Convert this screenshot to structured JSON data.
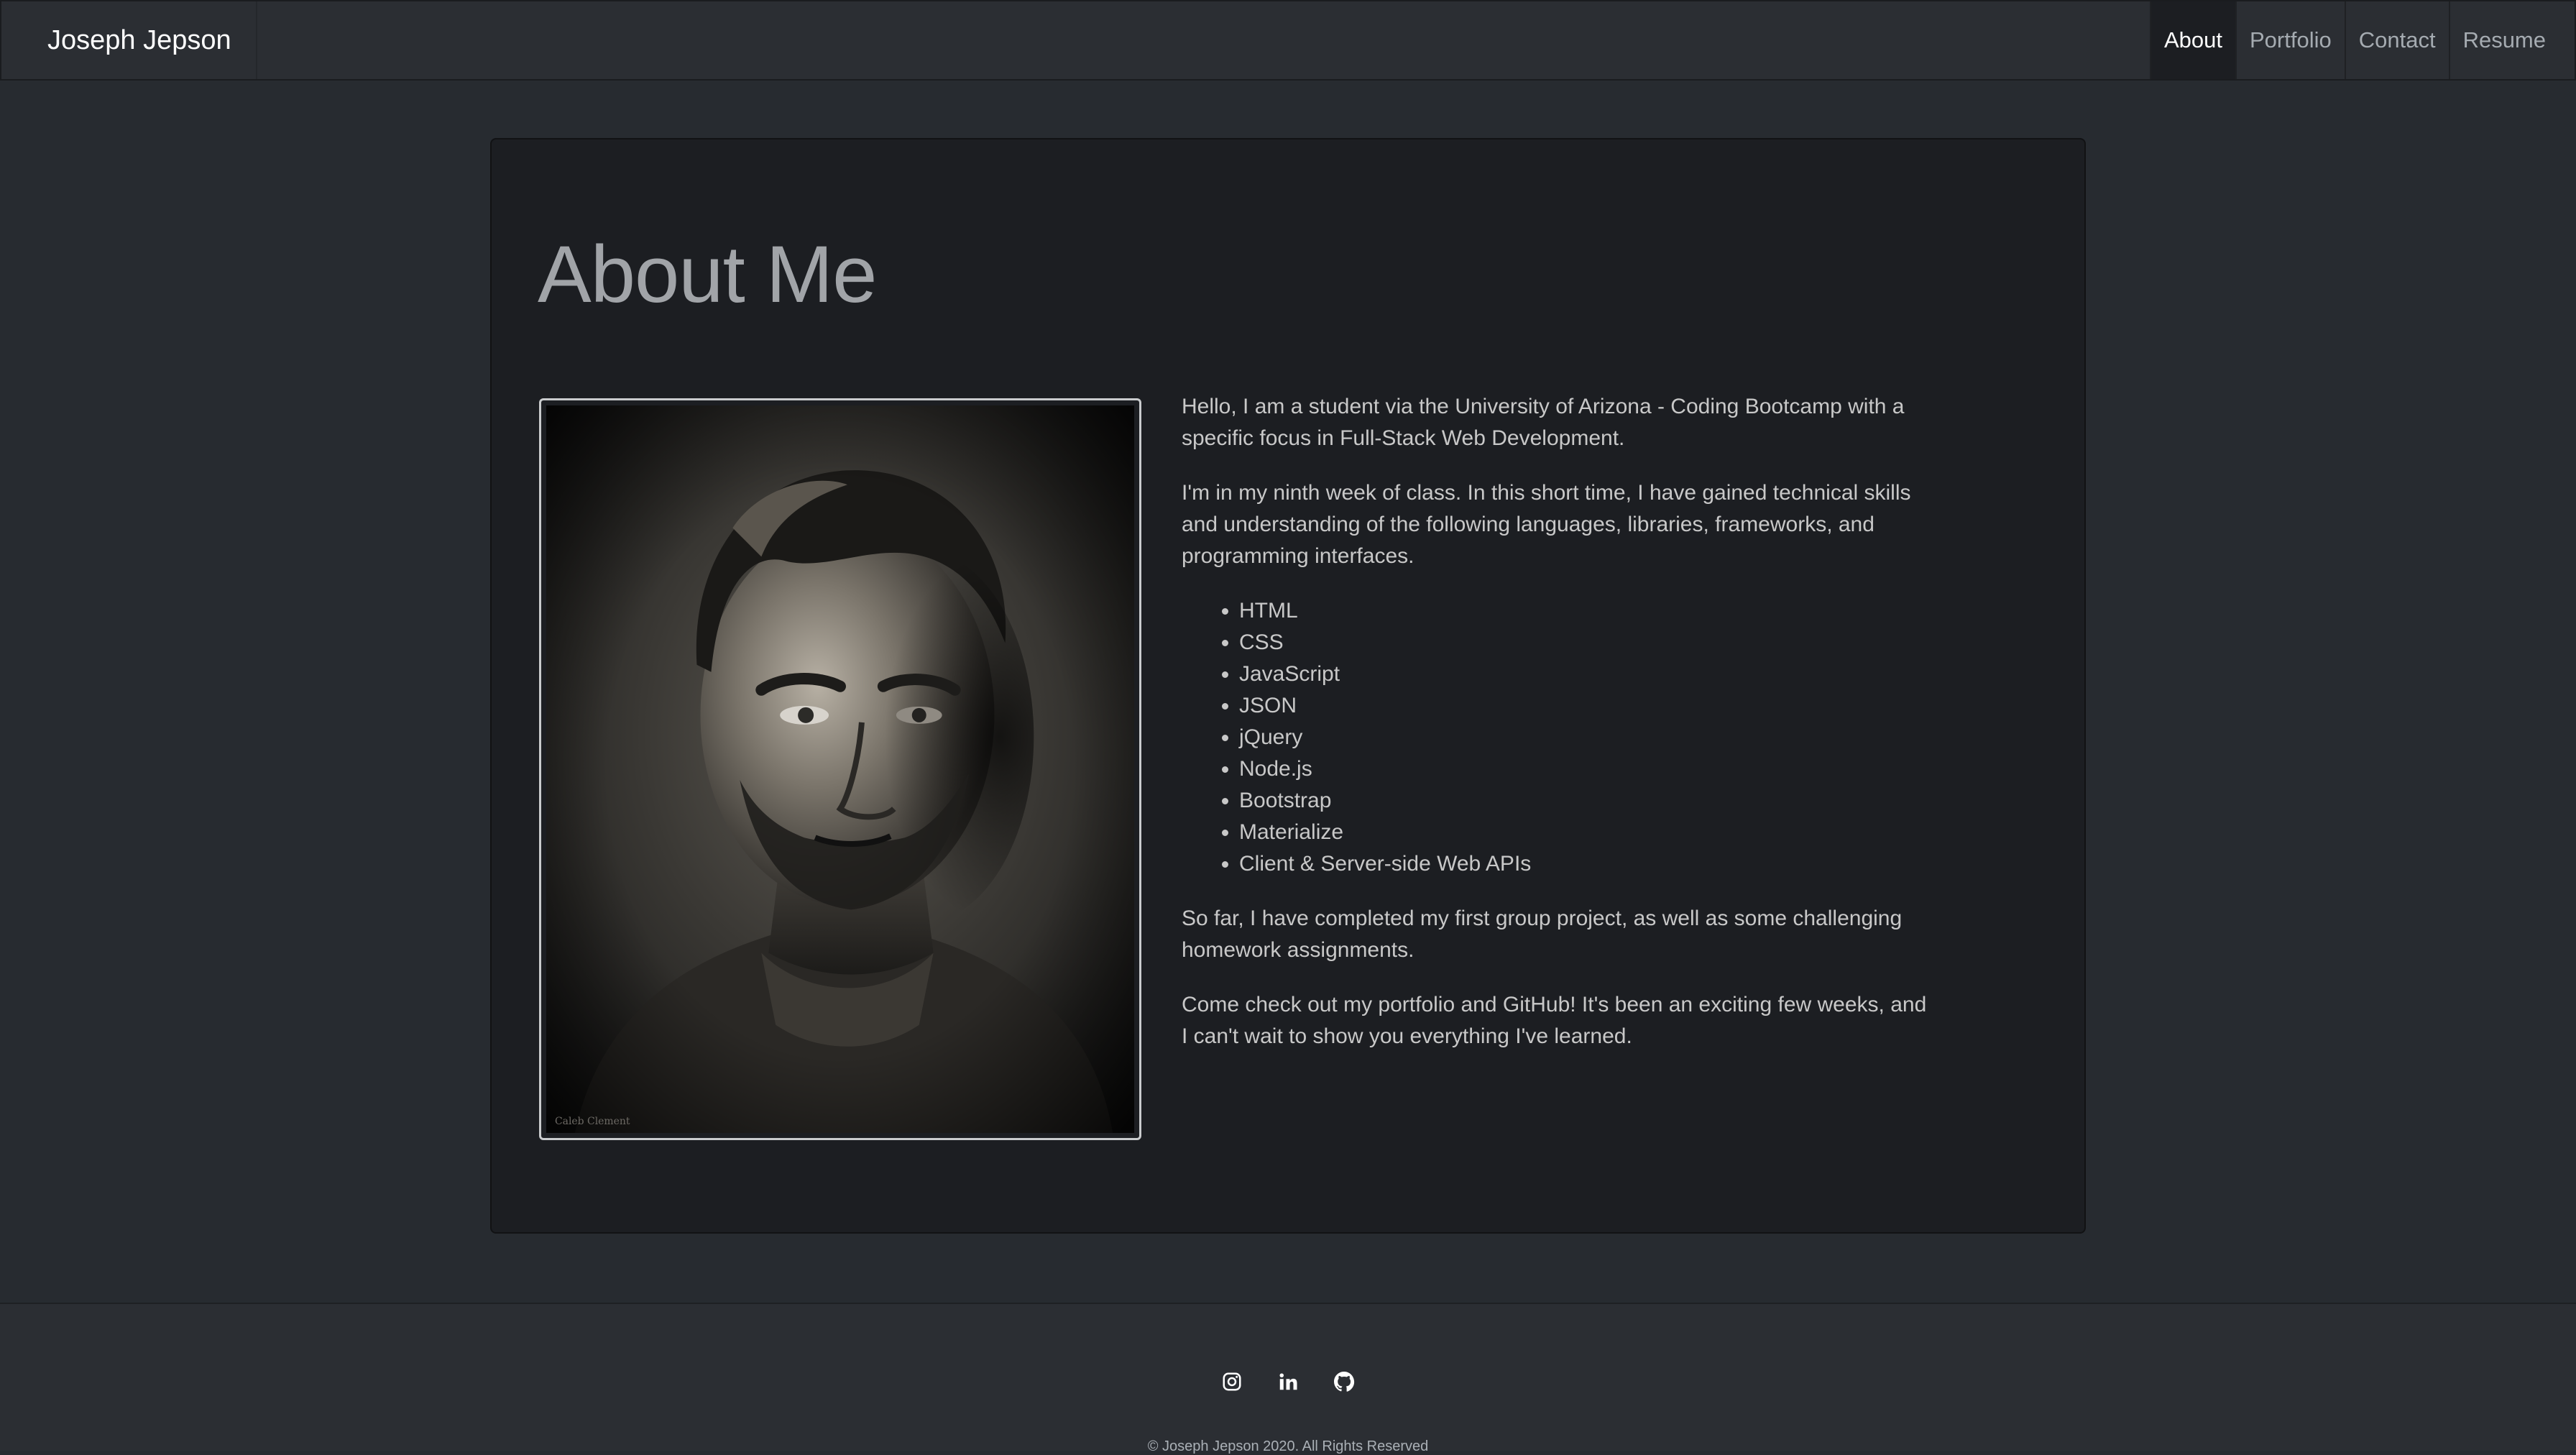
{
  "navbar": {
    "brand": "Joseph Jepson",
    "links": [
      {
        "label": "About",
        "active": true
      },
      {
        "label": "Portfolio",
        "active": false
      },
      {
        "label": "Contact",
        "active": false
      },
      {
        "label": "Resume",
        "active": false
      }
    ]
  },
  "main": {
    "title": "About Me",
    "portrait": {
      "icon": "portrait-photo",
      "signature": "Caleb Clement"
    },
    "paragraphs": [
      "Hello, I am a student via the University of Arizona - Coding Bootcamp with a specific focus in Full-Stack Web Development.",
      "I'm in my ninth week of class. In this short time, I have gained technical skills and understanding of the following languages, libraries, frameworks, and programming interfaces.",
      "So far, I have completed my first group project, as well as some challenging homework assignments.",
      "Come check out my portfolio and GitHub! It's been an exciting few weeks, and I can't wait to show you everything I've learned."
    ],
    "skills": [
      "HTML",
      "CSS",
      "JavaScript",
      "JSON",
      "jQuery",
      "Node.js",
      "Bootstrap",
      "Materialize",
      "Client & Server-side Web APIs"
    ]
  },
  "footer": {
    "socials": [
      "instagram-icon",
      "linkedin-icon",
      "github-icon"
    ],
    "copyright": "© Joseph Jepson 2020. All Rights Reserved"
  },
  "colors": {
    "background": "#272b30",
    "navbar": "#2b2e33",
    "card": "#1c1e22",
    "text": "#c8c8c8",
    "title": "#a1a4a8"
  }
}
